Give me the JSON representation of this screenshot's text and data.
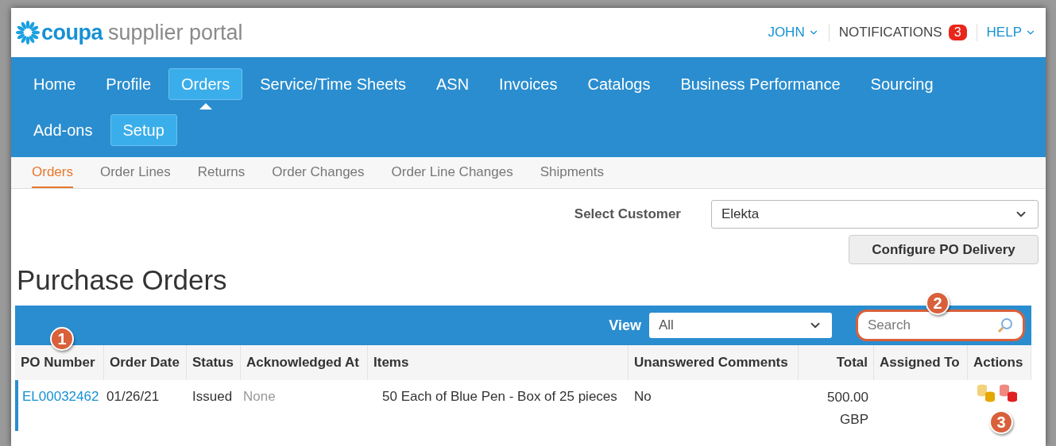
{
  "header": {
    "logo_brand": "coupa",
    "logo_product": "supplier portal",
    "user_menu": "JOHN",
    "notifications": {
      "label": "NOTIFICATIONS",
      "count": "3"
    },
    "help_menu": "HELP"
  },
  "nav": {
    "rows": [
      [
        {
          "label": "Home",
          "selected": false,
          "boxed": false
        },
        {
          "label": "Profile",
          "selected": false,
          "boxed": false
        },
        {
          "label": "Orders",
          "selected": true,
          "boxed": true
        },
        {
          "label": "Service/Time Sheets",
          "selected": false,
          "boxed": false
        },
        {
          "label": "ASN",
          "selected": false,
          "boxed": false
        },
        {
          "label": "Invoices",
          "selected": false,
          "boxed": false
        },
        {
          "label": "Catalogs",
          "selected": false,
          "boxed": false
        },
        {
          "label": "Business Performance",
          "selected": false,
          "boxed": false
        },
        {
          "label": "Sourcing",
          "selected": false,
          "boxed": false
        }
      ],
      [
        {
          "label": "Add-ons",
          "selected": false,
          "boxed": false
        },
        {
          "label": "Setup",
          "selected": false,
          "boxed": true
        }
      ]
    ]
  },
  "sub_tabs": [
    {
      "label": "Orders",
      "selected": true
    },
    {
      "label": "Order Lines",
      "selected": false
    },
    {
      "label": "Returns",
      "selected": false
    },
    {
      "label": "Order Changes",
      "selected": false
    },
    {
      "label": "Order Line Changes",
      "selected": false
    },
    {
      "label": "Shipments",
      "selected": false
    }
  ],
  "customer": {
    "label": "Select Customer",
    "value": "Elekta"
  },
  "configure_button": "Configure PO Delivery",
  "page_title": "Purchase Orders",
  "table": {
    "view_label": "View",
    "view_value": "All",
    "search": {
      "placeholder": "Search"
    },
    "columns": [
      "PO Number",
      "Order Date",
      "Status",
      "Acknowledged At",
      "Items",
      "Unanswered Comments",
      "Total",
      "Assigned To",
      "Actions"
    ],
    "rows": [
      {
        "po_number": "EL00032462",
        "order_date": "01/26/21",
        "status": "Issued",
        "acknowledged_at": "None",
        "items": "50 Each of Blue Pen - Box of 25 pieces",
        "unanswered_comments": "No",
        "total": "500.00",
        "currency": "GBP",
        "actions": [
          {
            "kind": "acknowledge"
          },
          {
            "kind": "flip"
          }
        ]
      }
    ]
  },
  "callouts": [
    "1",
    "2",
    "3"
  ]
}
